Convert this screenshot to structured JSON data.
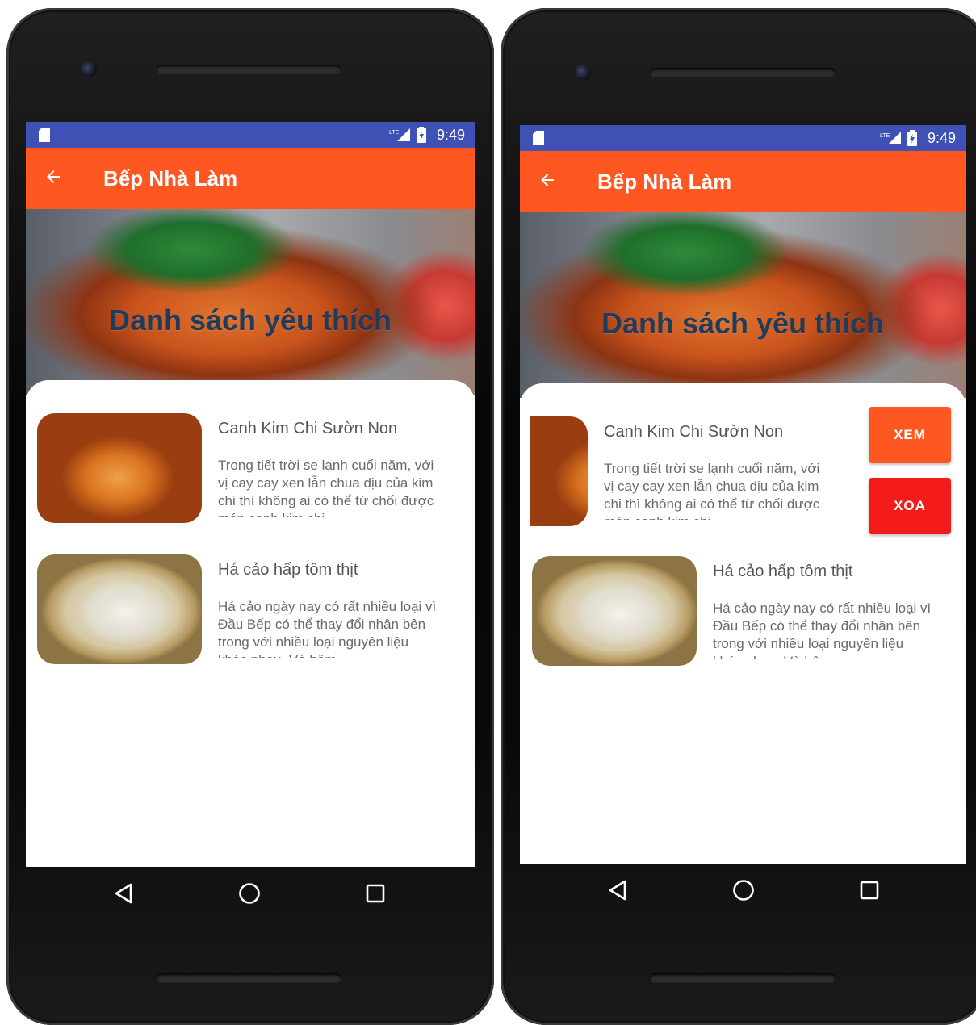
{
  "status": {
    "time": "9:49",
    "network": "LTE"
  },
  "app": {
    "title": "Bếp Nhà Làm"
  },
  "hero": {
    "title": "Danh sách yêu thích"
  },
  "favorites": [
    {
      "title": "Canh Kim Chi Sườn Non",
      "description": "Trong tiết trời se lạnh cuối năm, với vị cay cay xen lẫn chua dịu của kim chi thì không ai có thể từ chối được món canh kim chi"
    },
    {
      "title": "Há cảo hấp tôm thịt",
      "description": "Há cảo ngày nay có rất nhiều loại vì Đầu Bếp có thể thay đổi nhân bên trong với nhiều loại nguyên liệu khác nhau. Và hôm"
    }
  ],
  "actions": {
    "view_label": "XEM",
    "delete_label": "XOA"
  },
  "icons": {
    "back": "arrow-back-icon",
    "sd_card": "sd-card-icon",
    "signal": "lte-signal-icon",
    "battery": "battery-charging-icon",
    "nav_back": "nav-back-triangle-icon",
    "nav_home": "nav-home-circle-icon",
    "nav_recents": "nav-recents-square-icon"
  },
  "colors": {
    "statusbar": "#3f51b5",
    "appbar": "#ff5722",
    "xem_button": "#ff5722",
    "xoa_button": "#f41b1b",
    "hero_title": "#1f3c5c"
  }
}
